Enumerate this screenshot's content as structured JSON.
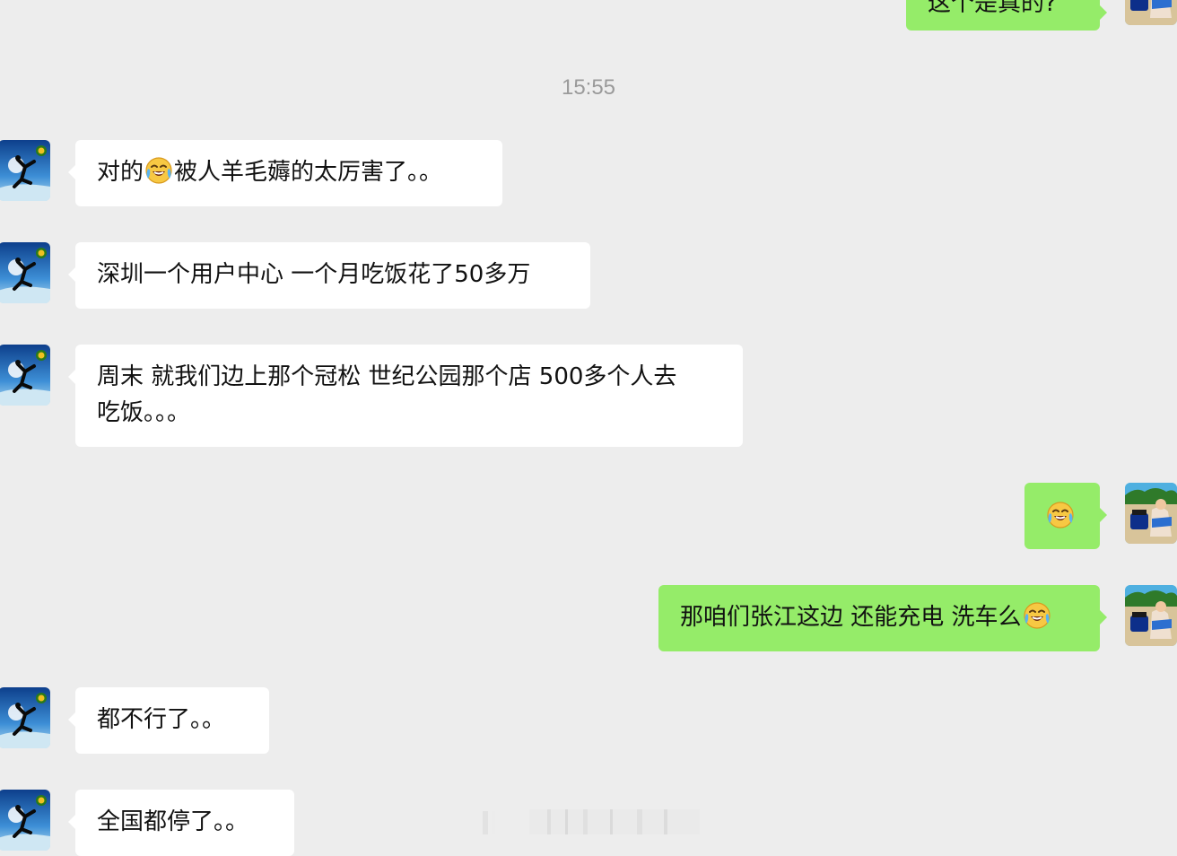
{
  "top_partial_message": {
    "text": "这个是真的?"
  },
  "timestamp": "15:55",
  "messages": [
    {
      "direction": "in",
      "parts": [
        "对的",
        "被人羊毛薅的太厉害了。。"
      ],
      "emoji": "laugh-cry"
    },
    {
      "direction": "in",
      "text": "深圳一个用户中心 一个月吃饭花了50多万"
    },
    {
      "direction": "in",
      "line1": "周末 就我们边上那个冠松 世纪公园那个店 500多个人去",
      "line2": "吃饭。。。"
    },
    {
      "direction": "out",
      "emoji_only": "laugh-cry"
    },
    {
      "direction": "out",
      "text": "那咱们张江这边 还能充电 洗车么",
      "emoji": "laugh-cry"
    },
    {
      "direction": "in",
      "text": "都不行了。。"
    },
    {
      "direction": "in",
      "text": "全国都停了。。"
    }
  ],
  "colors": {
    "background": "#ededed",
    "incoming_bubble": "#ffffff",
    "outgoing_bubble": "#95ec69",
    "timestamp": "#9a9a9a"
  },
  "icons": {
    "contact_avatar": "jumping-figure-avatar-icon",
    "self_avatar": "beach-photo-avatar-icon",
    "emoji": "laugh-cry-emoji-icon"
  }
}
